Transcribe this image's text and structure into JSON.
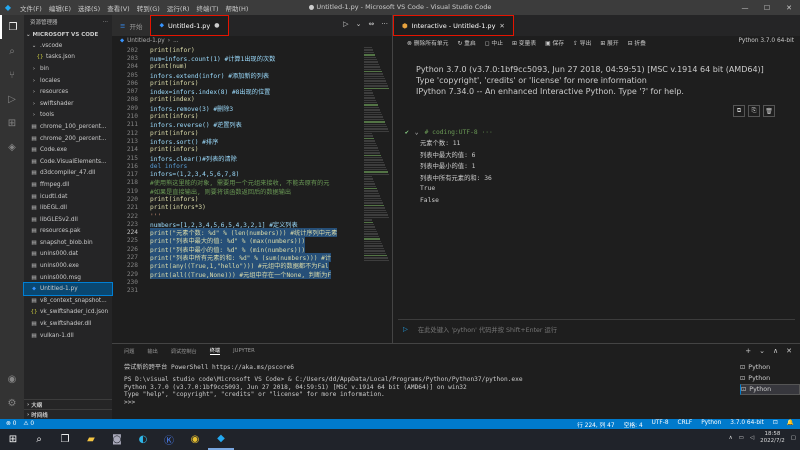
{
  "window": {
    "title": "● Untitled-1.py - Microsoft VS Code - Visual Studio Code",
    "menus": [
      "文件(F)",
      "编辑(E)",
      "选择(S)",
      "查看(V)",
      "转到(G)",
      "运行(R)",
      "终端(T)",
      "帮助(H)"
    ],
    "controls": [
      "—",
      "☐",
      "✕"
    ]
  },
  "activity_icons": [
    "files-icon",
    "search-icon",
    "source-control-icon",
    "run-debug-icon",
    "extensions-icon",
    "python-icon"
  ],
  "sidebar": {
    "header": "资源管理器",
    "header_more": "···",
    "section": "MICROSOFT VS CODE",
    "items": [
      {
        "label": ".vscode",
        "type": "folder-open",
        "indent": 1
      },
      {
        "label": "tasks.json",
        "type": "json",
        "indent": 2
      },
      {
        "label": "bin",
        "type": "folder",
        "indent": 1
      },
      {
        "label": "locales",
        "type": "folder",
        "indent": 1
      },
      {
        "label": "resources",
        "type": "folder",
        "indent": 1
      },
      {
        "label": "swiftshader",
        "type": "folder",
        "indent": 1
      },
      {
        "label": "tools",
        "type": "folder",
        "indent": 1
      },
      {
        "label": "chrome_100_percent...",
        "type": "file",
        "indent": 1
      },
      {
        "label": "chrome_200_percent...",
        "type": "file",
        "indent": 1
      },
      {
        "label": "Code.exe",
        "type": "file",
        "indent": 1
      },
      {
        "label": "Code.VisualElements...",
        "type": "file",
        "indent": 1
      },
      {
        "label": "d3dcompiler_47.dll",
        "type": "file",
        "indent": 1
      },
      {
        "label": "ffmpeg.dll",
        "type": "file",
        "indent": 1
      },
      {
        "label": "icudtl.dat",
        "type": "file",
        "indent": 1
      },
      {
        "label": "libEGL.dll",
        "type": "file",
        "indent": 1
      },
      {
        "label": "libGLESv2.dll",
        "type": "file",
        "indent": 1
      },
      {
        "label": "resources.pak",
        "type": "file",
        "indent": 1
      },
      {
        "label": "snapshot_blob.bin",
        "type": "file",
        "indent": 1
      },
      {
        "label": "unins000.dat",
        "type": "file",
        "indent": 1
      },
      {
        "label": "unins000.exe",
        "type": "file",
        "indent": 1
      },
      {
        "label": "unins000.msg",
        "type": "file",
        "indent": 1
      },
      {
        "label": "Untitled-1.py",
        "type": "py",
        "indent": 1,
        "active": true
      },
      {
        "label": "v8_context_snapshot...",
        "type": "file",
        "indent": 1
      },
      {
        "label": "vk_swiftshader_icd.json",
        "type": "json",
        "indent": 1
      },
      {
        "label": "vk_swiftshader.dll",
        "type": "file",
        "indent": 1
      },
      {
        "label": "vulkan-1.dll",
        "type": "file",
        "indent": 1
      }
    ],
    "bottom_sections": [
      "大纲",
      "时间线"
    ]
  },
  "editor": {
    "tabs": [
      {
        "label": "开始",
        "icon": "≡",
        "active": false
      },
      {
        "label": "Untitled-1.py",
        "icon": "●",
        "active": true
      }
    ],
    "breadcrumb": [
      "Untitled-1.py",
      "..."
    ],
    "actions": [
      "▷",
      "⌄",
      "⇔",
      "···"
    ],
    "lines": [
      {
        "n": "202",
        "t": "print(infor)",
        "k": "fn"
      },
      {
        "n": "203",
        "t": "num=infors.count(1) #计算1出现的次数",
        "k": "mix"
      },
      {
        "n": "204",
        "t": "print(num)",
        "k": "fn"
      },
      {
        "n": "205",
        "t": "infors.extend(infor) #添加新的列表",
        "k": "mix"
      },
      {
        "n": "206",
        "t": "print(infors)",
        "k": "fn"
      },
      {
        "n": "207",
        "t": "index=infors.index(8)  #8出现的位置",
        "k": "mix"
      },
      {
        "n": "208",
        "t": "print(index)",
        "k": "fn"
      },
      {
        "n": "209",
        "t": "infors.remove(3)  #删除3",
        "k": "mix"
      },
      {
        "n": "210",
        "t": "print(infors)",
        "k": "fn"
      },
      {
        "n": "211",
        "t": "infors.reverse() #逆置列表",
        "k": "mix"
      },
      {
        "n": "212",
        "t": "print(infors)",
        "k": "fn"
      },
      {
        "n": "213",
        "t": "infors.sort()  #排序",
        "k": "mix"
      },
      {
        "n": "214",
        "t": "print(infors)",
        "k": "fn"
      },
      {
        "n": "215",
        "t": "infors.clear()#列表的清除",
        "k": "mix"
      },
      {
        "n": "216",
        "t": "del infors",
        "k": "kw"
      },
      {
        "n": "217",
        "t": "infors=(1,2,3,4,5,6,7,8)",
        "k": "var"
      },
      {
        "n": "218",
        "t": "#使用熊这里能的对象, 需要用一个元组来接收, 不能去原有的元",
        "k": "cm"
      },
      {
        "n": "219",
        "t": "#如果是直接输出, 则要将该函数返回后的数据输出",
        "k": "cm"
      },
      {
        "n": "220",
        "t": "print(infors)",
        "k": "fn"
      },
      {
        "n": "221",
        "t": "print(infors*3)",
        "k": "fn"
      },
      {
        "n": "222",
        "t": "'''",
        "k": "str"
      },
      {
        "n": "223",
        "t": "numbers=[1,2,3,4,5,6,5,4,3,2,1]  #定义列表",
        "k": "mix"
      },
      {
        "n": "224",
        "t": "print(\"元素个数: %d\" % (len(numbers)))  #统计序列中元素",
        "k": "sel"
      },
      {
        "n": "225",
        "t": "print(\"列表中最大的值: %d\" % (max(numbers)))",
        "k": "sel"
      },
      {
        "n": "226",
        "t": "print(\"列表中最小的值: %d\" % (min(numbers)))",
        "k": "sel"
      },
      {
        "n": "227",
        "t": "print(\"列表中所有元素的和: %d\" % (sum(numbers)))  #计",
        "k": "sel"
      },
      {
        "n": "228",
        "t": "print(any((True,1,\"hello\")))  #元组中的数据都不为Fal",
        "k": "sel"
      },
      {
        "n": "229",
        "t": "print(all((True,None)))  #元组中存在一个None, 判断为F",
        "k": "sel"
      },
      {
        "n": "230",
        "t": "",
        "k": "fn"
      },
      {
        "n": "231",
        "t": "",
        "k": "fn"
      }
    ]
  },
  "interactive": {
    "tab_label": "Interactive - Untitled-1.py",
    "toolbar": [
      "⊗ 删除所有单元",
      "↻ 重启",
      "◻ 中止",
      "⊞ 变量表",
      "▣ 保存",
      "⇪ 导出",
      "⊞ 展开",
      "⊟ 折叠"
    ],
    "kernel": "Python 3.7.0 64-bit",
    "banner": [
      "Python 3.7.0 (v3.7.0:1bf9cc5093, Jun 27 2018, 04:59:51) [MSC v.1914 64 bit (AMD64)]",
      "Type 'copyright', 'credits' or 'license' for more information",
      "IPython 7.34.0 -- An enhanced Interactive Python. Type '?' for help."
    ],
    "cell_header": "# coding:UTF-8 ···",
    "outputs": [
      "元素个数: 11",
      "列表中最大的值: 6",
      "列表中最小的值: 1",
      "列表中所有元素的和: 36",
      "True",
      "False"
    ],
    "input_placeholder": "在此处键入 'python' 代码并按 Shift+Enter 运行"
  },
  "panel": {
    "tabs": [
      "问题",
      "输出",
      "调试控制台",
      "终端",
      "JUPYTER"
    ],
    "active_tab": "终端",
    "actions": [
      "+",
      "⌄",
      "∧",
      "✕"
    ],
    "terminal_lines": [
      "尝试新的跨平台 PowerShell https://aka.ms/pscore6",
      "",
      "PS D:\\visual studio code\\Microsoft VS Code> & C:/Users/dd/AppData/Local/Programs/Python/Python37/python.exe",
      "Python 3.7.0 (v3.7.0:1bf9cc5093, Jun 27 2018, 04:59:51) [MSC v.1914 64 bit (AMD64)] on win32",
      "Type \"help\", \"copyright\", \"credits\" or \"license\" for more information.",
      ">>>"
    ],
    "terminals": [
      "Python",
      "Python",
      "Python"
    ]
  },
  "status": {
    "left": [
      "⊗ 0",
      "⚠ 0"
    ],
    "right": [
      "行 224, 列 47",
      "空格: 4",
      "UTF-8",
      "CRLF",
      "Python",
      "3.7.0 64-bit",
      "⊡",
      "🔔"
    ]
  },
  "taskbar": {
    "apps": [
      "windows-icon",
      "search-icon",
      "file-explorer-icon",
      "camera-icon",
      "edge-icon",
      "app-k-icon",
      "chrome-icon",
      "vscode-icon"
    ],
    "time": "18:58",
    "date": "2022/7/2"
  }
}
